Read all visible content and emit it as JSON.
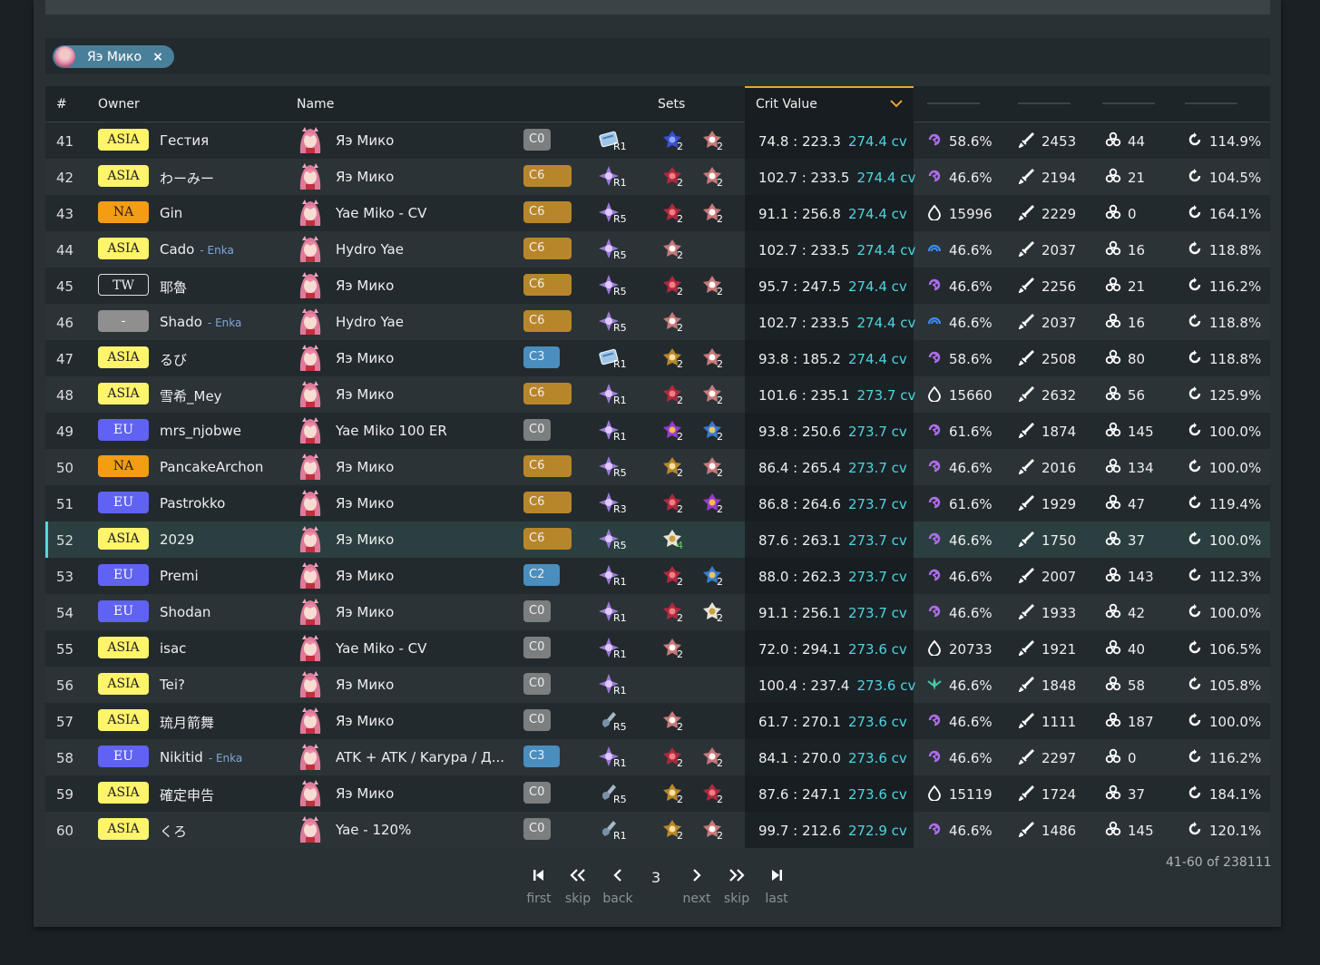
{
  "filter": {
    "character": "Яэ Мико",
    "remove_glyph": "×"
  },
  "headers": {
    "rank": "#",
    "owner": "Owner",
    "name": "Name",
    "sets": "Sets",
    "crit_value": "Crit Value"
  },
  "rows": [
    {
      "rank": "41",
      "region": "ASIA",
      "owner": "Гестия",
      "sub": "",
      "name": "Яэ Мико",
      "const": "C0",
      "weapon": "book",
      "wr": "R1",
      "sets": [
        [
          "blue",
          "2"
        ],
        [
          "red",
          "2"
        ]
      ],
      "cv": "74.8 : 223.3",
      "cvv": "274.4 cv",
      "s1i": "electro",
      "s1": "58.6%",
      "s2": "2453",
      "s3": "44",
      "s4": "114.9%"
    },
    {
      "rank": "42",
      "region": "ASIA",
      "owner": "わーみー",
      "sub": "",
      "name": "Яэ Мико",
      "const": "C6",
      "weapon": "catalyst",
      "wr": "R1",
      "sets": [
        [
          "crimson",
          "2"
        ],
        [
          "red",
          "2"
        ]
      ],
      "cv": "102.7 : 233.5",
      "cvv": "274.4 cv",
      "s1i": "electro",
      "s1": "46.6%",
      "s2": "2194",
      "s3": "21",
      "s4": "104.5%"
    },
    {
      "rank": "43",
      "region": "NA",
      "owner": "Gin",
      "sub": "",
      "name": "Yae Miko - CV",
      "const": "C6",
      "weapon": "catalyst",
      "wr": "R5",
      "sets": [
        [
          "crimson",
          "2"
        ],
        [
          "red",
          "2"
        ]
      ],
      "cv": "91.1 : 256.8",
      "cvv": "274.4 cv",
      "s1i": "hp",
      "s1": "15996",
      "s2": "2229",
      "s3": "0",
      "s4": "164.1%"
    },
    {
      "rank": "44",
      "region": "ASIA",
      "owner": "Cado",
      "sub": "- Enka",
      "name": "Hydro Yae",
      "const": "C6",
      "weapon": "catalyst",
      "wr": "R5",
      "sets": [
        [
          "red",
          "2"
        ]
      ],
      "cv": "102.7 : 233.5",
      "cvv": "274.4 cv",
      "s1i": "hydro",
      "s1": "46.6%",
      "s2": "2037",
      "s3": "16",
      "s4": "118.8%"
    },
    {
      "rank": "45",
      "region": "TW",
      "owner": "耶魯",
      "sub": "",
      "name": "Яэ Мико",
      "const": "C6",
      "weapon": "catalyst",
      "wr": "R5",
      "sets": [
        [
          "crimson",
          "2"
        ],
        [
          "red",
          "2"
        ]
      ],
      "cv": "95.7 : 247.5",
      "cvv": "274.4 cv",
      "s1i": "electro",
      "s1": "46.6%",
      "s2": "2256",
      "s3": "21",
      "s4": "116.2%"
    },
    {
      "rank": "46",
      "region": "-",
      "owner": "Shado",
      "sub": "- Enka",
      "name": "Hydro Yae",
      "const": "C6",
      "weapon": "catalyst",
      "wr": "R5",
      "sets": [
        [
          "red",
          "2"
        ]
      ],
      "cv": "102.7 : 233.5",
      "cvv": "274.4 cv",
      "s1i": "hydro",
      "s1": "46.6%",
      "s2": "2037",
      "s3": "16",
      "s4": "118.8%"
    },
    {
      "rank": "47",
      "region": "ASIA",
      "owner": "るび",
      "sub": "",
      "name": "Яэ Мико",
      "const": "C3",
      "weapon": "book",
      "wr": "R1",
      "sets": [
        [
          "gold",
          "2"
        ],
        [
          "red",
          "2"
        ]
      ],
      "cv": "93.8 : 185.2",
      "cvv": "274.4 cv",
      "s1i": "electro",
      "s1": "58.6%",
      "s2": "2508",
      "s3": "80",
      "s4": "118.8%"
    },
    {
      "rank": "48",
      "region": "ASIA",
      "owner": "雪希_Mey",
      "sub": "",
      "name": "Яэ Мико",
      "const": "C6",
      "weapon": "catalyst",
      "wr": "R1",
      "sets": [
        [
          "crimson",
          "2"
        ],
        [
          "red",
          "2"
        ]
      ],
      "cv": "101.6 : 235.1",
      "cvv": "273.7 cv",
      "s1i": "hp",
      "s1": "15660",
      "s2": "2632",
      "s3": "56",
      "s4": "125.9%"
    },
    {
      "rank": "49",
      "region": "EU",
      "owner": "mrs_njobwe",
      "sub": "",
      "name": "Yae Miko 100 ER",
      "const": "C0",
      "weapon": "catalyst",
      "wr": "R1",
      "sets": [
        [
          "purple",
          "2"
        ],
        [
          "bluegold",
          "2"
        ]
      ],
      "cv": "93.8 : 250.6",
      "cvv": "273.7 cv",
      "s1i": "electro",
      "s1": "61.6%",
      "s2": "1874",
      "s3": "145",
      "s4": "100.0%"
    },
    {
      "rank": "50",
      "region": "NA",
      "owner": "PancakeArchon",
      "sub": "",
      "name": "Яэ Мико",
      "const": "C6",
      "weapon": "catalyst",
      "wr": "R5",
      "sets": [
        [
          "gold",
          "2"
        ],
        [
          "red",
          "2"
        ]
      ],
      "cv": "86.4 : 265.4",
      "cvv": "273.7 cv",
      "s1i": "electro",
      "s1": "46.6%",
      "s2": "2016",
      "s3": "134",
      "s4": "100.0%"
    },
    {
      "rank": "51",
      "region": "EU",
      "owner": "Pastrokko",
      "sub": "",
      "name": "Яэ Мико",
      "const": "C6",
      "weapon": "catalyst",
      "wr": "R3",
      "sets": [
        [
          "crimson",
          "2"
        ],
        [
          "purple",
          "2"
        ]
      ],
      "cv": "86.8 : 264.6",
      "cvv": "273.7 cv",
      "s1i": "electro",
      "s1": "61.6%",
      "s2": "1929",
      "s3": "47",
      "s4": "119.4%"
    },
    {
      "rank": "52",
      "region": "ASIA",
      "owner": "2029",
      "sub": "",
      "name": "Яэ Мико",
      "const": "C6",
      "weapon": "catalyst",
      "wr": "R5",
      "sets": [
        [
          "white",
          "4"
        ]
      ],
      "cv": "87.6 : 263.1",
      "cvv": "273.7 cv",
      "s1i": "electro",
      "s1": "46.6%",
      "s2": "1750",
      "s3": "37",
      "s4": "100.0%",
      "hl": true
    },
    {
      "rank": "53",
      "region": "EU",
      "owner": "Premi",
      "sub": "",
      "name": "Яэ Мико",
      "const": "C2",
      "weapon": "catalyst",
      "wr": "R1",
      "sets": [
        [
          "crimson",
          "2"
        ],
        [
          "bluegold",
          "2"
        ]
      ],
      "cv": "88.0 : 262.3",
      "cvv": "273.7 cv",
      "s1i": "electro",
      "s1": "46.6%",
      "s2": "2007",
      "s3": "143",
      "s4": "112.3%"
    },
    {
      "rank": "54",
      "region": "EU",
      "owner": "Shodan",
      "sub": "",
      "name": "Яэ Мико",
      "const": "C0",
      "weapon": "catalyst",
      "wr": "R1",
      "sets": [
        [
          "crimson",
          "2"
        ],
        [
          "white",
          "2"
        ]
      ],
      "cv": "91.1 : 256.1",
      "cvv": "273.7 cv",
      "s1i": "electro",
      "s1": "46.6%",
      "s2": "1933",
      "s3": "42",
      "s4": "100.0%"
    },
    {
      "rank": "55",
      "region": "ASIA",
      "owner": "isac",
      "sub": "",
      "name": "Yae Miko - CV",
      "const": "C0",
      "weapon": "catalyst",
      "wr": "R1",
      "sets": [
        [
          "red",
          "2"
        ]
      ],
      "cv": "72.0 : 294.1",
      "cvv": "273.6 cv",
      "s1i": "hp",
      "s1": "20733",
      "s2": "1921",
      "s3": "40",
      "s4": "106.5%"
    },
    {
      "rank": "56",
      "region": "ASIA",
      "owner": "Tei?",
      "sub": "",
      "name": "Яэ Мико",
      "const": "C0",
      "weapon": "catalyst",
      "wr": "R1",
      "sets": [],
      "cv": "100.4 : 237.4",
      "cvv": "273.6 cv",
      "s1i": "anemo",
      "s1": "46.6%",
      "s2": "1848",
      "s3": "58",
      "s4": "105.8%"
    },
    {
      "rank": "57",
      "region": "ASIA",
      "owner": "琉月箭舞",
      "sub": "",
      "name": "Яэ Мико",
      "const": "C0",
      "weapon": "grey",
      "wr": "R5",
      "sets": [
        [
          "red",
          "2"
        ]
      ],
      "cv": "61.7 : 270.1",
      "cvv": "273.6 cv",
      "s1i": "electro",
      "s1": "46.6%",
      "s2": "1111",
      "s3": "187",
      "s4": "100.0%"
    },
    {
      "rank": "58",
      "region": "EU",
      "owner": "Nikitid",
      "sub": "- Enka",
      "name": "ATK + ATK / Karypa / Д...",
      "const": "C3",
      "weapon": "catalyst",
      "wr": "R1",
      "sets": [
        [
          "crimson",
          "2"
        ],
        [
          "red",
          "2"
        ]
      ],
      "cv": "84.1 : 270.0",
      "cvv": "273.6 cv",
      "s1i": "electro",
      "s1": "46.6%",
      "s2": "2297",
      "s3": "0",
      "s4": "116.2%"
    },
    {
      "rank": "59",
      "region": "ASIA",
      "owner": "確定申告",
      "sub": "",
      "name": "Яэ Мико",
      "const": "C0",
      "weapon": "grey",
      "wr": "R5",
      "sets": [
        [
          "gold",
          "2"
        ],
        [
          "crimson",
          "2"
        ]
      ],
      "cv": "87.6 : 247.1",
      "cvv": "273.6 cv",
      "s1i": "hp",
      "s1": "15119",
      "s2": "1724",
      "s3": "37",
      "s4": "184.1%"
    },
    {
      "rank": "60",
      "region": "ASIA",
      "owner": "くろ",
      "sub": "",
      "name": "Yae - 120%",
      "const": "C0",
      "weapon": "grey",
      "wr": "R1",
      "sets": [
        [
          "gold",
          "2"
        ],
        [
          "red",
          "2"
        ]
      ],
      "cv": "99.7 : 212.6",
      "cvv": "272.9 cv",
      "s1i": "electro",
      "s1": "46.6%",
      "s2": "1486",
      "s3": "145",
      "s4": "120.1%"
    }
  ],
  "pagination": {
    "range": "41-60 of 238111",
    "current": "3",
    "first": "first",
    "skip_back": "skip",
    "back": "back",
    "next": "next",
    "skip_next": "skip",
    "last": "last"
  },
  "colors": {
    "electro": "#b06cf0",
    "hydro": "#3c8cf0",
    "anemo": "#45c7a8",
    "cv": "#4ed4e0",
    "accent": "#e8a23a"
  }
}
